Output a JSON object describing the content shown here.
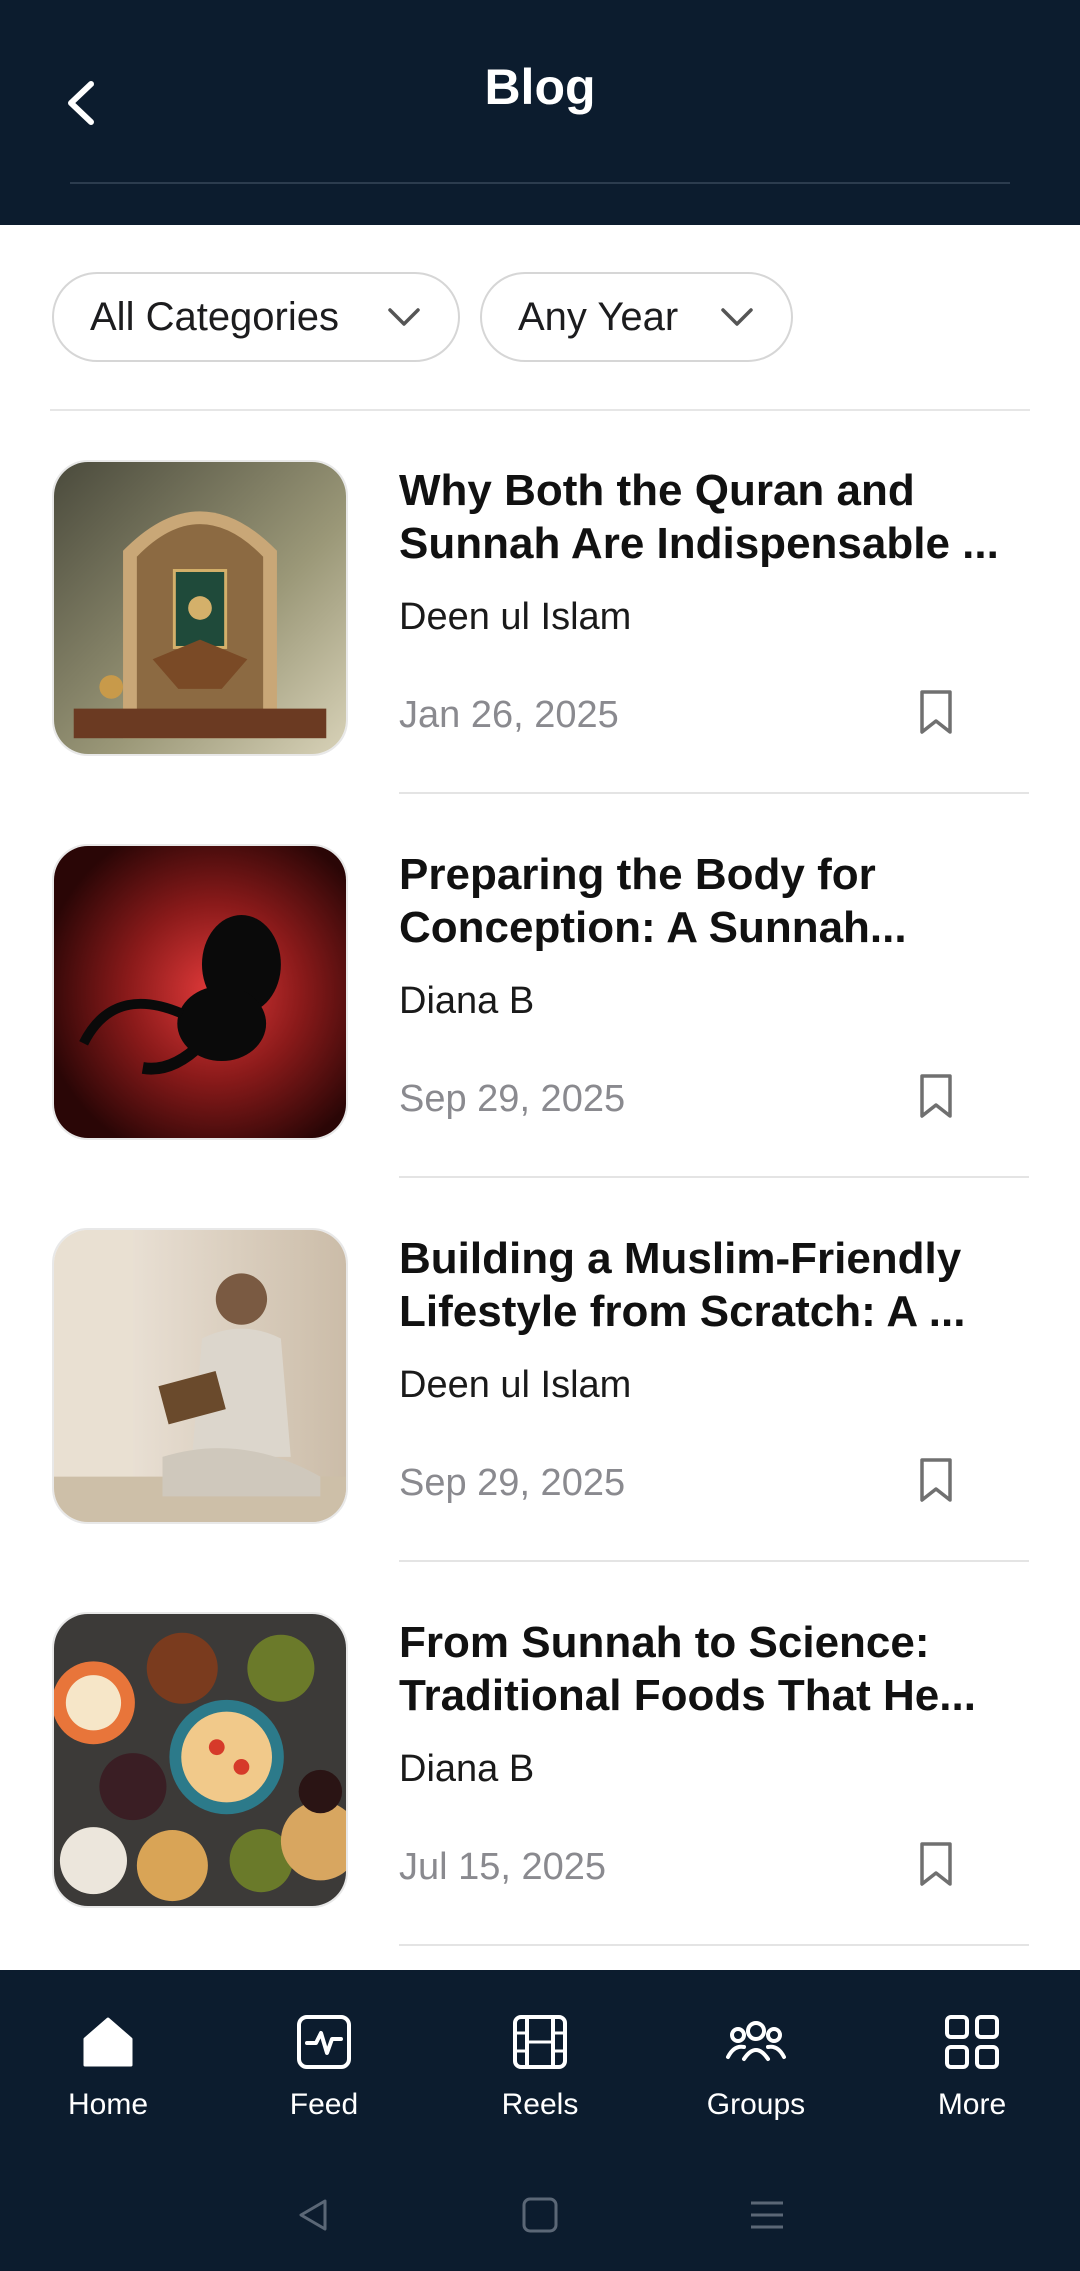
{
  "header": {
    "title": "Blog"
  },
  "filters": {
    "category": "All Categories",
    "year": "Any Year"
  },
  "posts": [
    {
      "title": "Why Both the Quran and Sunnah Are Indispensable ...",
      "author": "Deen ul Islam",
      "date": "Jan 26, 2025",
      "image": "quran-stand-image"
    },
    {
      "title": "Preparing the Body for Conception: A Sunnah...",
      "author": "Diana B",
      "date": "Sep 29, 2025",
      "image": "fetus-silhouette-image"
    },
    {
      "title": "Building a Muslim-Friendly Lifestyle from Scratch: A ...",
      "author": "Deen ul Islam",
      "date": "Sep 29, 2025",
      "image": "man-reading-image"
    },
    {
      "title": "From Sunnah to Science: Traditional Foods That He...",
      "author": "Diana B",
      "date": "Jul 15, 2025",
      "image": "food-spread-image"
    }
  ],
  "bottom_nav": {
    "items": [
      {
        "label": "Home",
        "icon": "home-icon"
      },
      {
        "label": "Feed",
        "icon": "activity-icon"
      },
      {
        "label": "Reels",
        "icon": "film-icon"
      },
      {
        "label": "Groups",
        "icon": "group-icon"
      },
      {
        "label": "More",
        "icon": "grid-icon"
      }
    ]
  },
  "colors": {
    "header_bg": "#0c1c2e",
    "nav_bg": "#0c1c2e",
    "date_text": "#8a8a8f",
    "divider": "#e4e4e4"
  }
}
